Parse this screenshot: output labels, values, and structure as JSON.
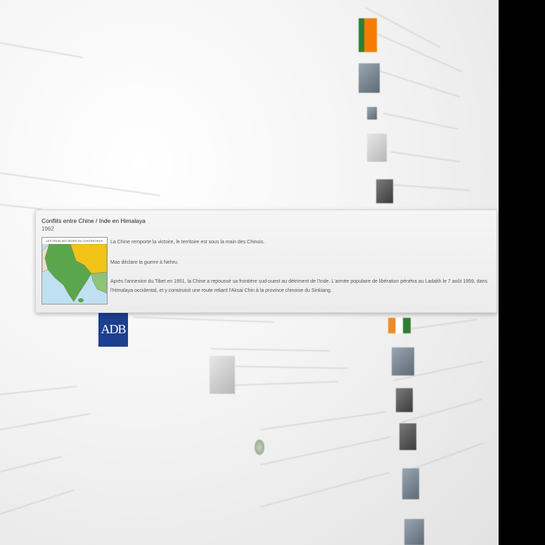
{
  "popup": {
    "title": "Conflits entre Chine / Inde en Himalaya",
    "year": "1962",
    "map_heading": "LES TROIS SECTEURS DU CONTENTIEUX SINO-INDIEN",
    "paragraphs": [
      "La Chine remporte la victoire, le territoire est sous la main des Chinois.",
      "Mao déclare la guerre à Nehru.",
      "Après l'annexion du Tibet en 1951, la Chine a repoussé sa frontière sud-ouest au détriment de l'Inde. L'armée populaire de libération pénétra au Ladakh le 7 août 1959, dans l'Himalaya occidental, et y construisit une route reliant l'Aksai Chin à la province chinoise du Sinkiang."
    ]
  },
  "background": {
    "logo_text": "ADB"
  },
  "colors": {
    "card_bg": "#f0f0f0",
    "logo_blue": "#1d3f8f",
    "map_green": "#5aa64c",
    "map_yellow": "#f2c418"
  }
}
